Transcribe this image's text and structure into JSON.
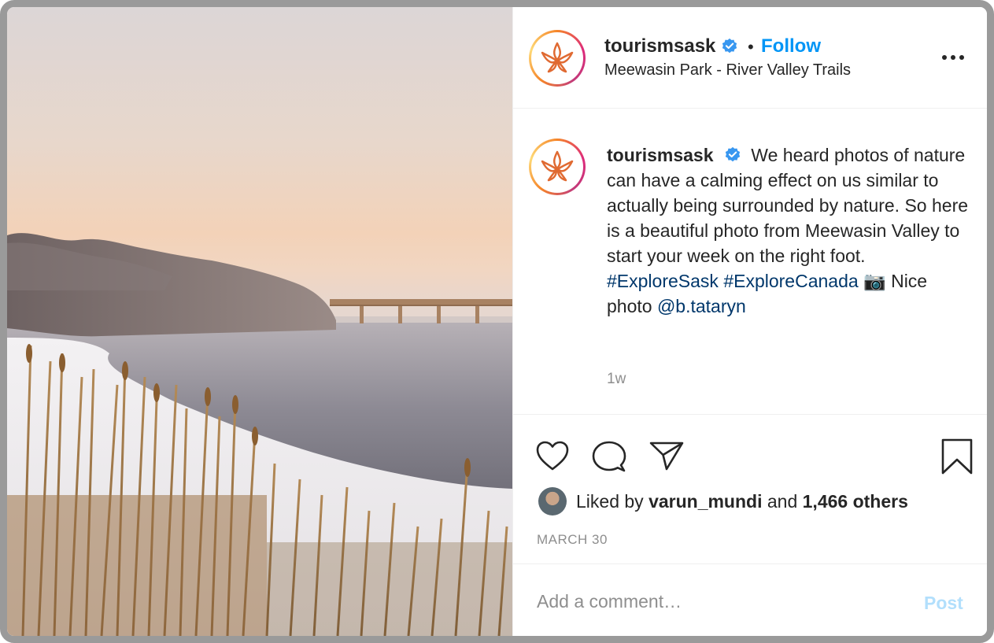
{
  "post": {
    "image": {
      "alt": ""
    },
    "header": {
      "username": "tourismsask",
      "separator": "•",
      "follow_label": "Follow",
      "location": "Meewasin Park - River Valley Trails",
      "verified_icon": "verified-badge-icon",
      "more_icon": "more-options-icon"
    },
    "caption": {
      "username": "tourismsask",
      "text": "We heard photos of nature can have a calming effect on us similar to actually being surrounded by nature. So here is a beautiful photo from Meewasin Valley to start your week on the right foot.",
      "hashtag_1": "#ExploreSask",
      "hashtag_2": "#ExploreCanada",
      "camera_emoji": "📷",
      "credit_text": "Nice photo",
      "mention": "@b.tataryn",
      "age": "1w"
    },
    "actions": {
      "like_icon": "heart-icon",
      "comment_icon": "comment-bubble-icon",
      "share_icon": "paper-plane-icon",
      "save_icon": "bookmark-icon"
    },
    "likes": {
      "prefix": "Liked by",
      "liker": "varun_mundi",
      "conjunction": "and",
      "others": "1,466 others"
    },
    "date": "MARCH 30",
    "comment": {
      "placeholder": "Add a comment…",
      "value": "",
      "post_label": "Post"
    },
    "colors": {
      "accent": "#0095f6",
      "post_disabled": "#b2dffc",
      "hashtag": "#00376b",
      "verified": "#3897f0"
    }
  }
}
